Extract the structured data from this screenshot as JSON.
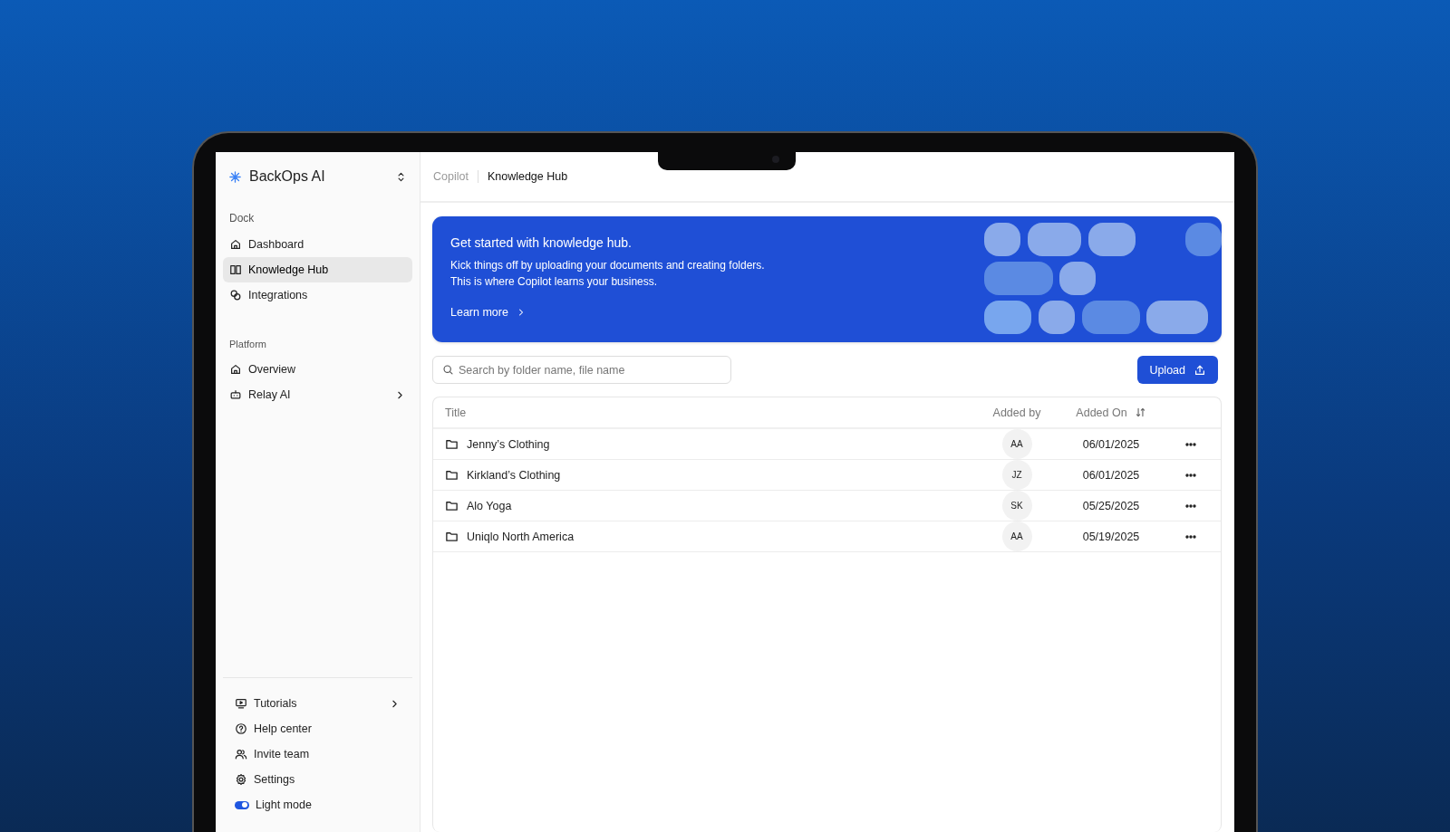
{
  "sidebar": {
    "brand": "BackOps AI",
    "sections": [
      {
        "label": "Dock",
        "items": [
          {
            "label": "Dashboard",
            "kind": "home",
            "selected": false,
            "has_submenu": false
          },
          {
            "label": "Knowledge Hub",
            "kind": "book",
            "selected": true,
            "has_submenu": false
          },
          {
            "label": "Integrations",
            "kind": "link",
            "selected": false,
            "has_submenu": false
          }
        ]
      },
      {
        "label": "Platform",
        "items": [
          {
            "label": "Overview",
            "kind": "home",
            "selected": false,
            "has_submenu": false
          },
          {
            "label": "Relay AI",
            "kind": "bot",
            "selected": false,
            "has_submenu": true
          }
        ]
      }
    ],
    "footer_items": [
      {
        "kind": "monitor",
        "label": "Tutorials",
        "has_submenu": true
      },
      {
        "kind": "help",
        "label": "Help center",
        "has_submenu": false
      },
      {
        "kind": "users",
        "label": "Invite team",
        "has_submenu": false
      },
      {
        "kind": "gear",
        "label": "Settings",
        "has_submenu": false
      },
      {
        "kind": "toggle",
        "label": "Light mode",
        "on": true
      }
    ]
  },
  "breadcrumb": [
    {
      "label": "Copilot",
      "current": false
    },
    {
      "label": "Knowledge Hub",
      "current": true
    }
  ],
  "banner": {
    "title": "Get started with knowledge hub.",
    "lines": [
      "Kick things off by uploading your documents and creating folders.",
      "This is where Copilot learns your business."
    ],
    "link": "Learn more"
  },
  "search": {
    "placeholder": "Search by folder name, file name"
  },
  "upload_button": "Upload",
  "table": {
    "columns": [
      "Title",
      "Added by",
      "Added On"
    ],
    "rows": [
      {
        "title": "Jenny’s Clothing",
        "added_by": "AA",
        "added_on": "06/01/2025"
      },
      {
        "title": "Kirkland’s Clothing",
        "added_by": "JZ",
        "added_on": "06/01/2025"
      },
      {
        "title": "Alo Yoga",
        "added_by": "SK",
        "added_on": "05/25/2025"
      },
      {
        "title": "Uniqlo North America",
        "added_by": "AA",
        "added_on": "05/19/2025"
      }
    ]
  }
}
